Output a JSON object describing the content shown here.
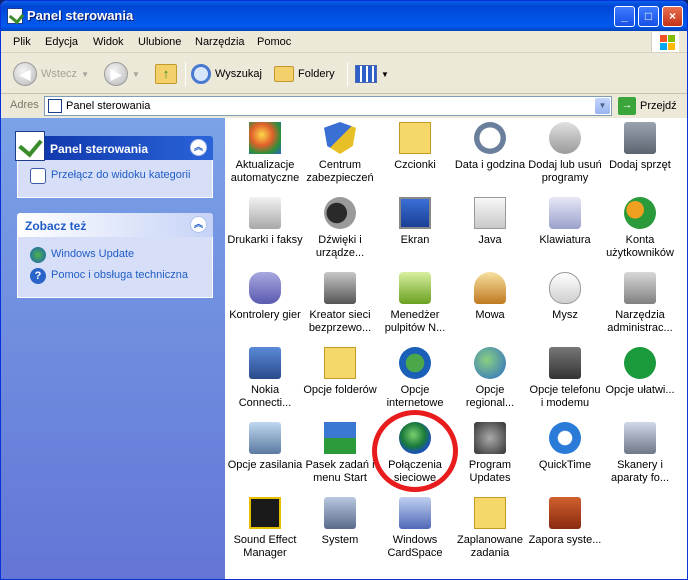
{
  "window": {
    "title": "Panel sterowania"
  },
  "menu": [
    "Plik",
    "Edycja",
    "Widok",
    "Ulubione",
    "Narzędzia",
    "Pomoc"
  ],
  "toolbar": {
    "back": "Wstecz",
    "search": "Wyszukaj",
    "folders": "Foldery"
  },
  "address": {
    "label": "Adres",
    "value": "Panel sterowania",
    "go": "Przejdź"
  },
  "sidebar": {
    "cp_panel": {
      "title": "Panel sterowania",
      "link": "Przełącz do widoku kategorii"
    },
    "see_also": {
      "title": "Zobacz też",
      "links": [
        "Windows Update",
        "Pomoc i obsługa techniczna"
      ]
    }
  },
  "items": [
    "Aktualizacje automatyczne",
    "Centrum zabezpieczeń",
    "Czcionki",
    "Data i godzina",
    "Dodaj lub usuń programy",
    "Dodaj sprzęt",
    "Drukarki i faksy",
    "Dźwięki i urządze...",
    "Ekran",
    "Java",
    "Klawiatura",
    "Konta użytkowników",
    "Kontrolery gier",
    "Kreator sieci bezprzewo...",
    "Menedżer pulpitów N...",
    "Mowa",
    "Mysz",
    "Narzędzia administrac...",
    "Nokia Connecti...",
    "Opcje folderów",
    "Opcje internetowe",
    "Opcje regional...",
    "Opcje telefonu i modemu",
    "Opcje ułatwi...",
    "Opcje zasilania",
    "Pasek zadań i menu Start",
    "Połączenia sieciowe",
    "Program Updates",
    "QuickTime",
    "Skanery i aparaty fo...",
    "Sound Effect Manager",
    "System",
    "Windows CardSpace",
    "Zaplanowane zadania",
    "Zapora syste..."
  ],
  "colors": {
    "title_blue": "#0153e4",
    "sidebar_blue": "#6375d6",
    "highlight": "#e81c1c",
    "link_blue": "#215dc6"
  }
}
